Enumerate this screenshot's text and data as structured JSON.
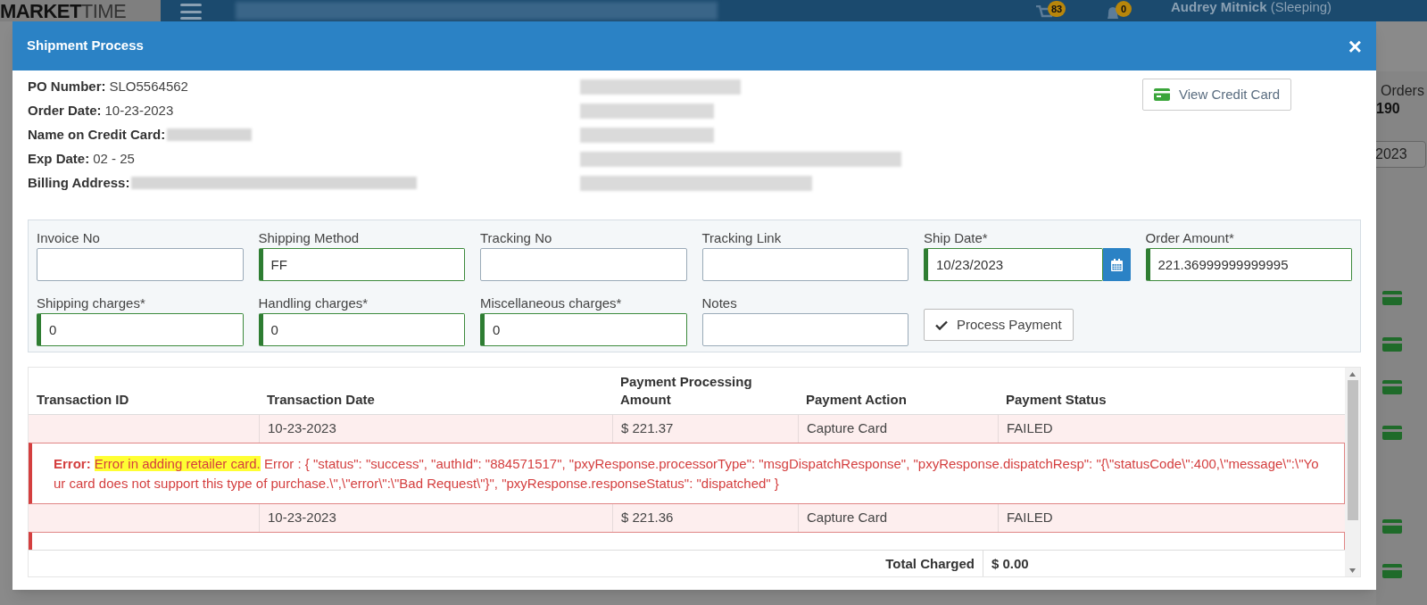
{
  "background": {
    "logo_bold": "MARKET",
    "logo_light": "TIME",
    "nav_redacted": true,
    "cart_count": "83",
    "notification_count": "0",
    "user_name": "Audrey Mitnick",
    "user_status": "(Sleeping)",
    "side_label": "Orders",
    "side_value": "190",
    "side_date": "2023"
  },
  "modal": {
    "title": "Shipment Process",
    "close": "×"
  },
  "order_info": [
    {
      "label": "PO Number:",
      "value": "SLO5564562",
      "redacted": false
    },
    {
      "label": "Order Date:",
      "value": "10-23-2023",
      "redacted": false
    },
    {
      "label": "Name on Credit Card:",
      "redacted": true
    },
    {
      "label": "Exp Date:",
      "value": "02 - 25",
      "redacted": false
    },
    {
      "label": "Billing Address:",
      "redacted": true
    }
  ],
  "address_lines": [
    {
      "redacted": true
    },
    {
      "redacted": true
    },
    {
      "redacted": true
    },
    {
      "redacted": true
    },
    {
      "redacted": true
    }
  ],
  "view_card_button": "View Credit Card",
  "fields": [
    {
      "label": "Invoice No",
      "valid": false,
      "kind": "text"
    },
    {
      "label": "Shipping Method",
      "value": "FF",
      "valid": true,
      "kind": "text"
    },
    {
      "label": "Tracking No",
      "valid": false,
      "kind": "text"
    },
    {
      "label": "Tracking Link",
      "valid": false,
      "kind": "text"
    },
    {
      "label": "Ship Date*",
      "value": "10/23/2023",
      "valid": true,
      "kind": "date"
    },
    {
      "label": "Order Amount*",
      "value": "221.36999999999995",
      "valid": true,
      "kind": "text"
    },
    {
      "label": "Shipping charges*",
      "value": "0",
      "valid": true,
      "kind": "text"
    },
    {
      "label": "Handling charges*",
      "value": "0",
      "valid": true,
      "kind": "text"
    },
    {
      "label": "Miscellaneous charges*",
      "value": "0",
      "valid": true,
      "kind": "text"
    },
    {
      "label": "Notes",
      "valid": false,
      "kind": "text"
    }
  ],
  "process_button": "Process Payment",
  "table": {
    "columns": [
      "Transaction ID",
      "Transaction Date",
      "Payment Processing Amount",
      "Payment Action",
      "Payment Status"
    ],
    "rows": [
      {
        "kind": "transaction",
        "date": "10-23-2023",
        "amount": "$ 221.37",
        "action": "Capture Card",
        "status": "FAILED"
      },
      {
        "kind": "error",
        "label": "Error:",
        "highlight": "Error in adding retailer card.",
        "detail": " Error : { \"status\": \"success\", \"authId\": \"884571517\", \"pxyResponse.processorType\": \"msgDispatchResponse\", \"pxyResponse.dispatchResp\": \"{\\\"statusCode\\\":400,\\\"message\\\":\\\"Your card does not support this type of purchase.\\\",\\\"error\\\":\\\"Bad Request\\\"}\", \"pxyResponse.responseStatus\": \"dispatched\" }"
      },
      {
        "kind": "transaction",
        "date": "10-23-2023",
        "amount": "$ 221.36",
        "action": "Capture Card",
        "status": "FAILED"
      },
      {
        "kind": "error_hidden"
      }
    ],
    "total": {
      "label": "Total Charged",
      "value": "$ 0.00"
    }
  }
}
